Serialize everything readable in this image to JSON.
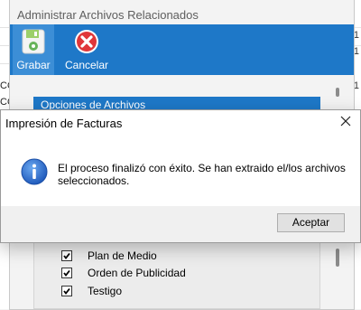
{
  "background": {
    "left_fragments": [
      "CO",
      "CO"
    ],
    "right_fragments": [
      "1",
      "1",
      "1"
    ]
  },
  "parent_window": {
    "title": "Administrar Archivos Relacionados",
    "toolbar": {
      "save_label": "Grabar",
      "cancel_label": "Cancelar"
    },
    "panel_header": "Opciones de Archivos",
    "file_options": [
      {
        "label": "Plan de Medio",
        "checked": true
      },
      {
        "label": "Orden de Publicidad",
        "checked": true
      },
      {
        "label": "Testigo",
        "checked": true
      }
    ]
  },
  "dialog": {
    "title": "Impresión de Facturas",
    "message": "El proceso finalizó con éxito. Se han extraido el/los archivos seleccionados.",
    "accept_label": "Aceptar",
    "icon": "info-icon",
    "close_icon": "close-icon"
  },
  "colors": {
    "toolbar": "#1e78c8",
    "accent": "#1e78c8"
  }
}
